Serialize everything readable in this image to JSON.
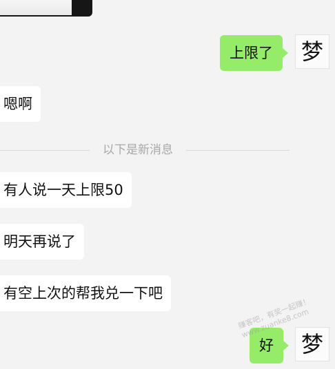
{
  "chat": {
    "messages": [
      {
        "side": "right",
        "text": "上限了",
        "avatar": "梦"
      },
      {
        "side": "left",
        "text": "嗯啊"
      },
      {
        "side": "left",
        "text": "有人说一天上限50"
      },
      {
        "side": "left",
        "text": "明天再说了"
      },
      {
        "side": "left",
        "text": "有空上次的帮我兑一下吧"
      },
      {
        "side": "right",
        "text": "好",
        "avatar": "梦"
      }
    ],
    "divider": "以下是新消息",
    "watermark": {
      "line1": "赚客吧，有奖一起赚！",
      "line2": "www.zuanke8.com"
    }
  }
}
